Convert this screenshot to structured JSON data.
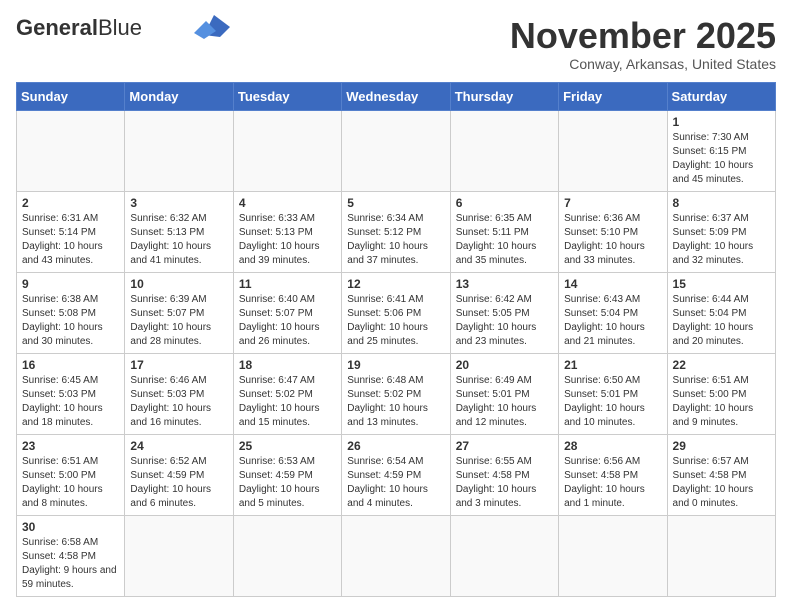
{
  "header": {
    "logo_line1": "General",
    "logo_line2": "Blue",
    "title": "November 2025",
    "subtitle": "Conway, Arkansas, United States"
  },
  "weekdays": [
    "Sunday",
    "Monday",
    "Tuesday",
    "Wednesday",
    "Thursday",
    "Friday",
    "Saturday"
  ],
  "weeks": [
    [
      {
        "day": "",
        "info": ""
      },
      {
        "day": "",
        "info": ""
      },
      {
        "day": "",
        "info": ""
      },
      {
        "day": "",
        "info": ""
      },
      {
        "day": "",
        "info": ""
      },
      {
        "day": "",
        "info": ""
      },
      {
        "day": "1",
        "info": "Sunrise: 7:30 AM\nSunset: 6:15 PM\nDaylight: 10 hours and 45 minutes."
      }
    ],
    [
      {
        "day": "2",
        "info": "Sunrise: 6:31 AM\nSunset: 5:14 PM\nDaylight: 10 hours and 43 minutes."
      },
      {
        "day": "3",
        "info": "Sunrise: 6:32 AM\nSunset: 5:13 PM\nDaylight: 10 hours and 41 minutes."
      },
      {
        "day": "4",
        "info": "Sunrise: 6:33 AM\nSunset: 5:13 PM\nDaylight: 10 hours and 39 minutes."
      },
      {
        "day": "5",
        "info": "Sunrise: 6:34 AM\nSunset: 5:12 PM\nDaylight: 10 hours and 37 minutes."
      },
      {
        "day": "6",
        "info": "Sunrise: 6:35 AM\nSunset: 5:11 PM\nDaylight: 10 hours and 35 minutes."
      },
      {
        "day": "7",
        "info": "Sunrise: 6:36 AM\nSunset: 5:10 PM\nDaylight: 10 hours and 33 minutes."
      },
      {
        "day": "8",
        "info": "Sunrise: 6:37 AM\nSunset: 5:09 PM\nDaylight: 10 hours and 32 minutes."
      }
    ],
    [
      {
        "day": "9",
        "info": "Sunrise: 6:38 AM\nSunset: 5:08 PM\nDaylight: 10 hours and 30 minutes."
      },
      {
        "day": "10",
        "info": "Sunrise: 6:39 AM\nSunset: 5:07 PM\nDaylight: 10 hours and 28 minutes."
      },
      {
        "day": "11",
        "info": "Sunrise: 6:40 AM\nSunset: 5:07 PM\nDaylight: 10 hours and 26 minutes."
      },
      {
        "day": "12",
        "info": "Sunrise: 6:41 AM\nSunset: 5:06 PM\nDaylight: 10 hours and 25 minutes."
      },
      {
        "day": "13",
        "info": "Sunrise: 6:42 AM\nSunset: 5:05 PM\nDaylight: 10 hours and 23 minutes."
      },
      {
        "day": "14",
        "info": "Sunrise: 6:43 AM\nSunset: 5:04 PM\nDaylight: 10 hours and 21 minutes."
      },
      {
        "day": "15",
        "info": "Sunrise: 6:44 AM\nSunset: 5:04 PM\nDaylight: 10 hours and 20 minutes."
      }
    ],
    [
      {
        "day": "16",
        "info": "Sunrise: 6:45 AM\nSunset: 5:03 PM\nDaylight: 10 hours and 18 minutes."
      },
      {
        "day": "17",
        "info": "Sunrise: 6:46 AM\nSunset: 5:03 PM\nDaylight: 10 hours and 16 minutes."
      },
      {
        "day": "18",
        "info": "Sunrise: 6:47 AM\nSunset: 5:02 PM\nDaylight: 10 hours and 15 minutes."
      },
      {
        "day": "19",
        "info": "Sunrise: 6:48 AM\nSunset: 5:02 PM\nDaylight: 10 hours and 13 minutes."
      },
      {
        "day": "20",
        "info": "Sunrise: 6:49 AM\nSunset: 5:01 PM\nDaylight: 10 hours and 12 minutes."
      },
      {
        "day": "21",
        "info": "Sunrise: 6:50 AM\nSunset: 5:01 PM\nDaylight: 10 hours and 10 minutes."
      },
      {
        "day": "22",
        "info": "Sunrise: 6:51 AM\nSunset: 5:00 PM\nDaylight: 10 hours and 9 minutes."
      }
    ],
    [
      {
        "day": "23",
        "info": "Sunrise: 6:51 AM\nSunset: 5:00 PM\nDaylight: 10 hours and 8 minutes."
      },
      {
        "day": "24",
        "info": "Sunrise: 6:52 AM\nSunset: 4:59 PM\nDaylight: 10 hours and 6 minutes."
      },
      {
        "day": "25",
        "info": "Sunrise: 6:53 AM\nSunset: 4:59 PM\nDaylight: 10 hours and 5 minutes."
      },
      {
        "day": "26",
        "info": "Sunrise: 6:54 AM\nSunset: 4:59 PM\nDaylight: 10 hours and 4 minutes."
      },
      {
        "day": "27",
        "info": "Sunrise: 6:55 AM\nSunset: 4:58 PM\nDaylight: 10 hours and 3 minutes."
      },
      {
        "day": "28",
        "info": "Sunrise: 6:56 AM\nSunset: 4:58 PM\nDaylight: 10 hours and 1 minute."
      },
      {
        "day": "29",
        "info": "Sunrise: 6:57 AM\nSunset: 4:58 PM\nDaylight: 10 hours and 0 minutes."
      }
    ],
    [
      {
        "day": "30",
        "info": "Sunrise: 6:58 AM\nSunset: 4:58 PM\nDaylight: 9 hours and 59 minutes."
      },
      {
        "day": "",
        "info": ""
      },
      {
        "day": "",
        "info": ""
      },
      {
        "day": "",
        "info": ""
      },
      {
        "day": "",
        "info": ""
      },
      {
        "day": "",
        "info": ""
      },
      {
        "day": "",
        "info": ""
      }
    ]
  ]
}
